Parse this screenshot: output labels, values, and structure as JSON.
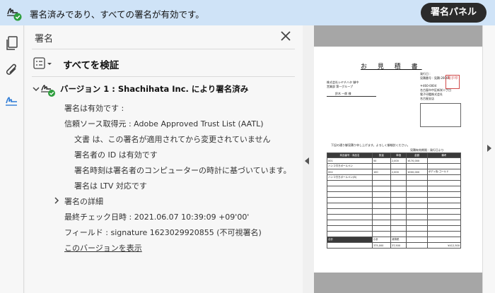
{
  "banner": {
    "message": "署名済みであり、すべての署名が有効です。",
    "panel_button": "署名パネル"
  },
  "sidebar": {
    "title": "署名",
    "verify_all": "すべてを検証",
    "version": {
      "title": "バージョン 1 : Shachihata Inc. により署名済み",
      "status": "署名は有効です :",
      "trust_source": "信頼ソース取得元 : Adobe Approved Trust List (AATL)",
      "doc_unchanged": "文書 は、この署名が適用されてから変更されていません",
      "signer_id": "署名者の ID は有効です",
      "signing_time": "署名時刻は署名者のコンピューターの時計に基づいています。",
      "ltv": "署名は LTV 対応です",
      "details": "署名の詳細",
      "last_checked": "最終チェック日時 : 2021.06.07 10:39:09 +09'00'",
      "field": "フィールド : signature 1623029920855 (不可視署名)",
      "view_version": "このバージョンを表示"
    }
  },
  "document": {
    "title": "お 見 積 書",
    "issue_no": "発行日 :",
    "estimate_no": "見積番号 : 見積-20001",
    "client_company": "株式会社シヤチハタ 御中",
    "client_dept": "営業部 第一グループ",
    "client_person": "鈴木 一郎 様",
    "postal": "〒460-0004",
    "addr1": "名古屋市中区新栄二丁目",
    "addr2": "電子印鑑株式会社",
    "addr3": "名古屋支店",
    "stamp": "電子印",
    "note": "下記の通り御見積り申し上げます。よろしく御検討ください。",
    "valid": "見積有効期限 : 発行日より",
    "headers": [
      "商品番号・商品名",
      "数量",
      "単価",
      "金額",
      "備考"
    ],
    "rows": [
      [
        "001",
        "50",
        "2,000",
        "¥170,000",
        ""
      ],
      [
        "ハンコ付きボールペン",
        "",
        "",
        "",
        ""
      ],
      [
        "002",
        "100",
        "2,000",
        "¥200,000",
        "ボディ色:ゴールド"
      ],
      [
        "ハンコ付きボールペン(B)",
        "",
        "",
        "",
        ""
      ]
    ],
    "totals_label": "合計",
    "subtotal_label": "小計",
    "tax_label": "消費税",
    "subtotal": "375,000",
    "tax": "37,500",
    "total": "¥412,500"
  }
}
